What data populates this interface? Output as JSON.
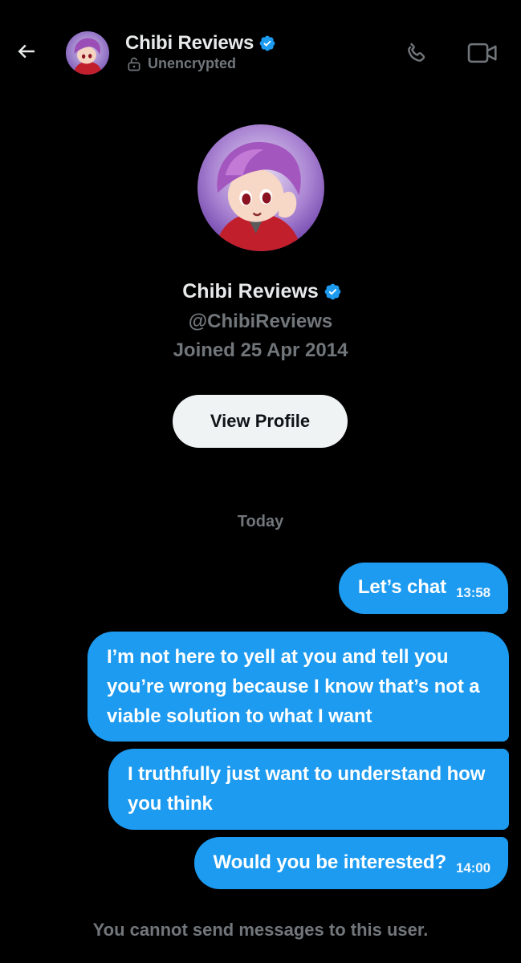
{
  "header": {
    "name": "Chibi Reviews",
    "encryption_status": "Unencrypted",
    "icons": {
      "back": "back-arrow-icon",
      "verified": "verified-badge-icon",
      "lock": "unlock-icon",
      "call": "phone-icon",
      "video": "video-camera-icon"
    }
  },
  "profile": {
    "name": "Chibi Reviews",
    "handle": "@ChibiReviews",
    "joined": "Joined 25 Apr 2014",
    "view_profile_label": "View Profile"
  },
  "conversation": {
    "day_label": "Today",
    "messages": [
      {
        "text": "Let’s chat",
        "time": "13:58",
        "outgoing": true
      },
      {
        "text": "I’m not here to yell at you and tell you you’re wrong because I know that’s not a viable solution to what I want",
        "time": "",
        "outgoing": true
      },
      {
        "text": "I truthfully just want to understand how you think",
        "time": "",
        "outgoing": true
      },
      {
        "text": "Would you be interested?",
        "time": "14:00",
        "outgoing": true
      }
    ],
    "footer_note": "You cannot send messages to this user."
  },
  "colors": {
    "background": "#000000",
    "bubble": "#1d9bf0",
    "muted_text": "#71767b",
    "primary_text": "#e7e9ea",
    "verified": "#1d9bf0"
  }
}
